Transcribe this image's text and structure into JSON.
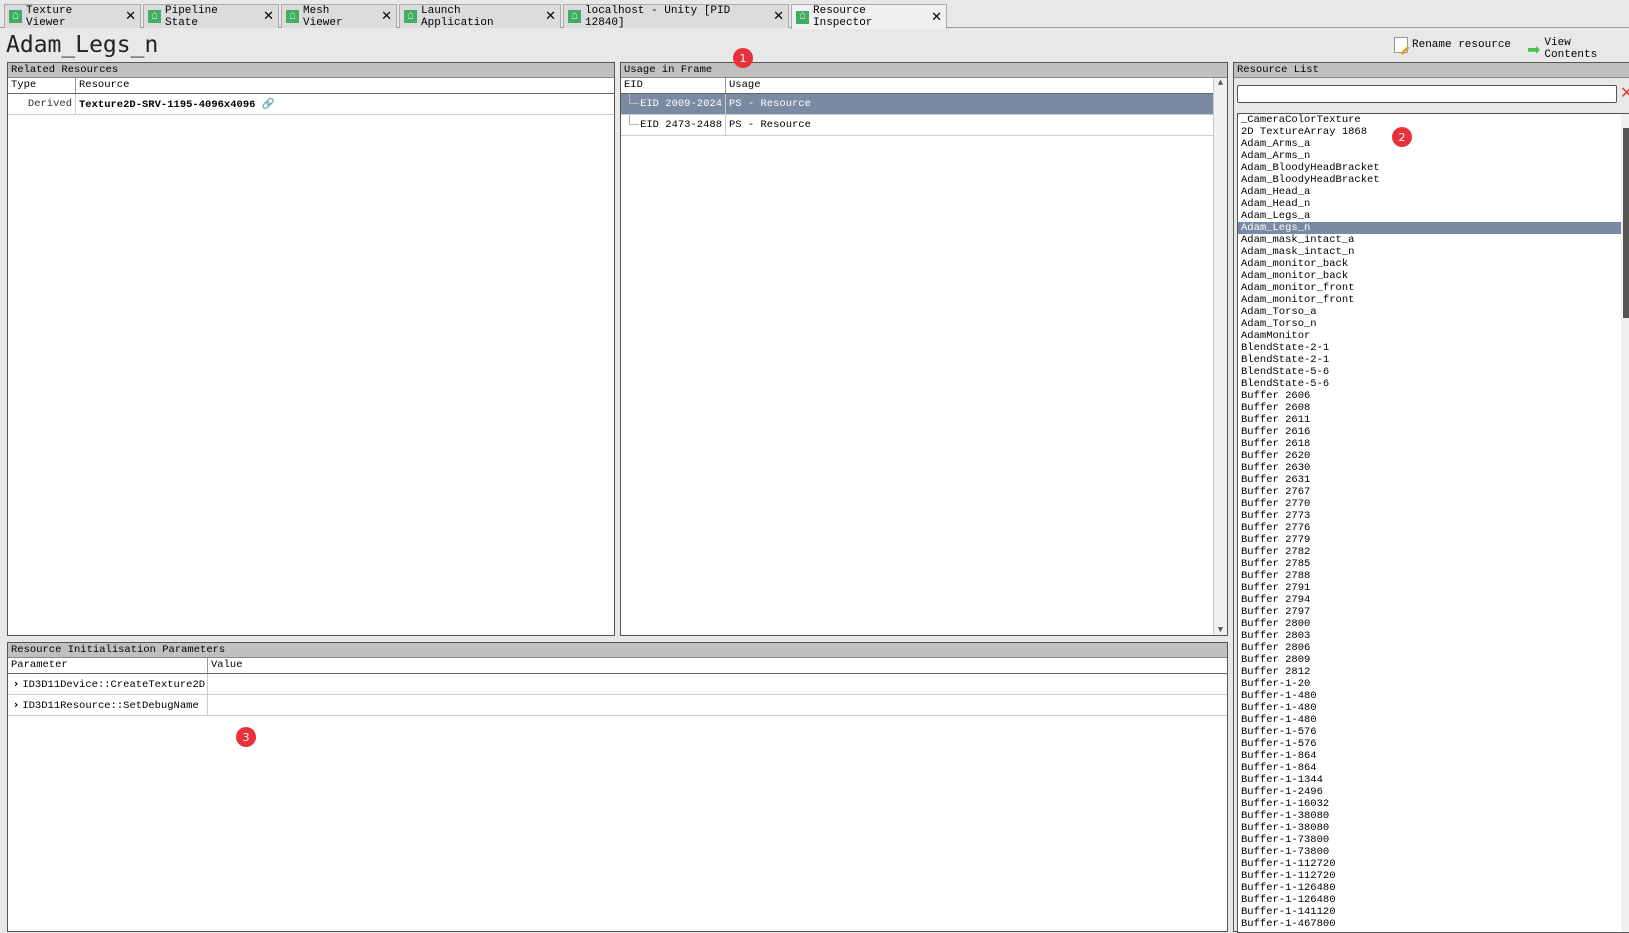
{
  "tabs": [
    {
      "label": "Texture Viewer",
      "active": false
    },
    {
      "label": "Pipeline State",
      "active": false
    },
    {
      "label": "Mesh Viewer",
      "active": false
    },
    {
      "label": "Launch Application",
      "active": false
    },
    {
      "label": "localhost - Unity [PID 12840]",
      "active": false
    },
    {
      "label": "Resource Inspector",
      "active": true
    }
  ],
  "title": "Adam_Legs_n",
  "toolbar": {
    "rename_label": "Rename resource",
    "view_label": "View Contents"
  },
  "related": {
    "title": "Related Resources",
    "columns": [
      "Type",
      "Resource"
    ],
    "rows": [
      {
        "type": "Derived",
        "resource": "Texture2D-SRV-1195-4096x4096"
      }
    ]
  },
  "usage": {
    "title": "Usage in Frame",
    "columns": [
      "EID",
      "Usage"
    ],
    "rows": [
      {
        "eid": "EID 2009-2024",
        "usage": "PS - Resource",
        "selected": true
      },
      {
        "eid": "EID 2473-2488",
        "usage": "PS - Resource",
        "selected": false
      }
    ]
  },
  "init": {
    "title": "Resource Initialisation Parameters",
    "columns": [
      "Parameter",
      "Value"
    ],
    "rows": [
      {
        "param": "ID3D11Device::CreateTexture2D",
        "value": ""
      },
      {
        "param": "ID3D11Resource::SetDebugName",
        "value": ""
      }
    ]
  },
  "resource_list": {
    "title": "Resource List",
    "search_value": "",
    "selected": "Adam_Legs_n",
    "items": [
      "_CameraColorTexture",
      "2D TextureArray 1868",
      "Adam_Arms_a",
      "Adam_Arms_n",
      "Adam_BloodyHeadBracket",
      "Adam_BloodyHeadBracket",
      "Adam_Head_a",
      "Adam_Head_n",
      "Adam_Legs_a",
      "Adam_Legs_n",
      "Adam_mask_intact_a",
      "Adam_mask_intact_n",
      "Adam_monitor_back",
      "Adam_monitor_back",
      "Adam_monitor_front",
      "Adam_monitor_front",
      "Adam_Torso_a",
      "Adam_Torso_n",
      "AdamMonitor",
      "BlendState-2-1",
      "BlendState-2-1",
      "BlendState-5-6",
      "BlendState-5-6",
      "Buffer 2606",
      "Buffer 2608",
      "Buffer 2611",
      "Buffer 2616",
      "Buffer 2618",
      "Buffer 2620",
      "Buffer 2630",
      "Buffer 2631",
      "Buffer 2767",
      "Buffer 2770",
      "Buffer 2773",
      "Buffer 2776",
      "Buffer 2779",
      "Buffer 2782",
      "Buffer 2785",
      "Buffer 2788",
      "Buffer 2791",
      "Buffer 2794",
      "Buffer 2797",
      "Buffer 2800",
      "Buffer 2803",
      "Buffer 2806",
      "Buffer 2809",
      "Buffer 2812",
      "Buffer-1-20",
      "Buffer-1-480",
      "Buffer-1-480",
      "Buffer-1-480",
      "Buffer-1-576",
      "Buffer-1-576",
      "Buffer-1-864",
      "Buffer-1-864",
      "Buffer-1-1344",
      "Buffer-1-2496",
      "Buffer-1-16032",
      "Buffer-1-38080",
      "Buffer-1-38080",
      "Buffer-1-73800",
      "Buffer-1-73800",
      "Buffer-1-112720",
      "Buffer-1-112720",
      "Buffer-1-126480",
      "Buffer-1-126480",
      "Buffer-1-141120",
      "Buffer-1-467800"
    ]
  },
  "badges": [
    "1",
    "2",
    "3"
  ],
  "colors": {
    "selection": "#7a8aa3",
    "tab_icon": "#3fae62",
    "badge": "#e8313a"
  }
}
